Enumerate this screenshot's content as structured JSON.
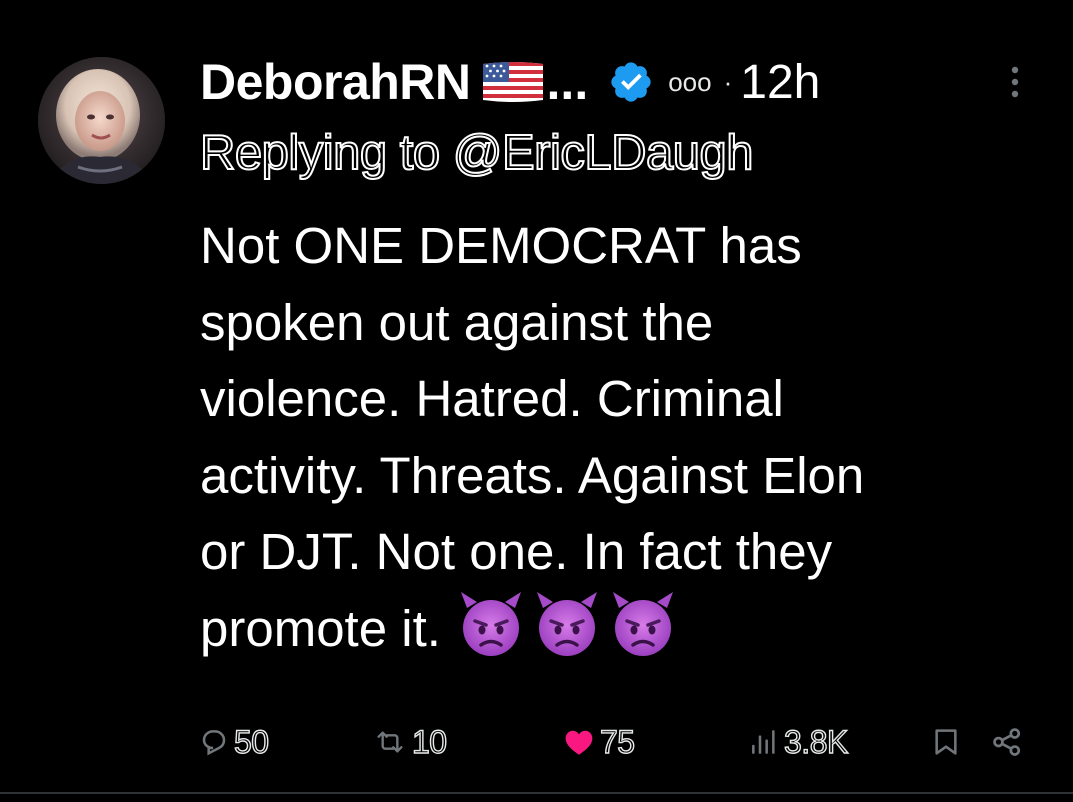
{
  "tweet": {
    "display_name": "DeborahRN",
    "name_truncation": "...",
    "flag_icon": "us-flag-icon",
    "verified_color": "#1d9bf0",
    "org_badge_dots": "ooo",
    "separator": "·",
    "timestamp": "12h",
    "reply_to_text": "Replying to @EricLDaugh",
    "body_lines": [
      "Not ONE DEMOCRAT has",
      "spoken out against the",
      "violence. Hatred. Criminal",
      "activity. Threats. Against Elon",
      "or DJT. Not one. In fact they",
      "promote it."
    ],
    "emoji_count": 3,
    "emoji_name": "angry-devil-emoji"
  },
  "actions": {
    "replies": "50",
    "reposts": "10",
    "likes": "75",
    "views": "3.8K",
    "like_color": "#f91880"
  }
}
